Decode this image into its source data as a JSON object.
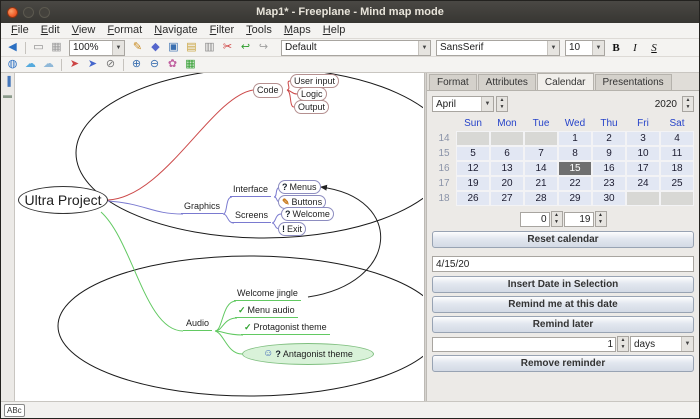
{
  "window": {
    "title": "Map1* - Freeplane - Mind map mode"
  },
  "menubar": {
    "items": [
      "File",
      "Edit",
      "View",
      "Format",
      "Navigate",
      "Filter",
      "Tools",
      "Maps",
      "Help"
    ]
  },
  "toolbar": {
    "zoom_value": "100%",
    "style_value": "Default",
    "font_value": "SansSerif",
    "size_value": "10",
    "bold_label": "B",
    "italic_label": "I",
    "strike_label": "S",
    "row1a_icons": [
      {
        "name": "speaker-icon",
        "glyph": "◀",
        "color": "#2b6fc2"
      },
      {
        "sep": true
      },
      {
        "name": "show-selection-icon",
        "glyph": "▭",
        "color": "#8a8a8a"
      },
      {
        "name": "spotlight-icon",
        "glyph": "▦",
        "color": "#9a9a9a"
      }
    ],
    "row1b_icons": [
      {
        "name": "pencil-icon",
        "glyph": "✎",
        "color": "#c8881a"
      },
      {
        "name": "style-icon",
        "glyph": "◆",
        "color": "#5566cc"
      },
      {
        "name": "save-icon",
        "glyph": "▣",
        "color": "#3a6fb0"
      },
      {
        "name": "open-folder-icon",
        "glyph": "▤",
        "color": "#c8a23a"
      },
      {
        "name": "print-icon",
        "glyph": "▥",
        "color": "#8a8a8a"
      },
      {
        "name": "cut-icon",
        "glyph": "✂",
        "color": "#cc3333"
      },
      {
        "name": "undo-icon",
        "glyph": "↩",
        "color": "#2f9e2f"
      },
      {
        "name": "redo-icon",
        "glyph": "↪",
        "color": "#9e9e9e"
      }
    ],
    "row2_icons": [
      {
        "name": "globe-icon",
        "glyph": "◍",
        "color": "#2b6fc2"
      },
      {
        "name": "cloud-icon",
        "glyph": "☁",
        "color": "#55aadd"
      },
      {
        "name": "cloud-shadow-icon",
        "glyph": "☁",
        "color": "#8fb8d8"
      },
      {
        "sep": true
      },
      {
        "name": "arrow-link-icon",
        "glyph": "➤",
        "color": "#cc4444"
      },
      {
        "name": "hyperlink-icon",
        "glyph": "➤",
        "color": "#4466cc"
      },
      {
        "name": "remove-format-icon",
        "glyph": "⊘",
        "color": "#777777"
      },
      {
        "sep": true
      },
      {
        "name": "zoom-in-icon",
        "glyph": "⊕",
        "color": "#3a6fb0"
      },
      {
        "name": "zoom-out-icon",
        "glyph": "⊖",
        "color": "#3a6fb0"
      },
      {
        "name": "icon-palette-icon",
        "glyph": "✿",
        "color": "#c060a0"
      },
      {
        "name": "grid-icon",
        "glyph": "▦",
        "color": "#2f9e2f"
      }
    ]
  },
  "sidebar": {
    "icons": [
      {
        "name": "format-panel-toggle-icon",
        "glyph": "▐",
        "color": "#4477bb"
      },
      {
        "name": "note-panel-toggle-icon",
        "glyph": "▬",
        "color": "#8a9a8a"
      }
    ]
  },
  "map": {
    "nodes": {
      "root": "Ultra Project",
      "code": "Code",
      "user_input": "User input",
      "logic": "Logic",
      "output": "Output",
      "graphics": "Graphics",
      "interface": "Interface",
      "screens": "Screens",
      "menus": "Menus",
      "buttons": "Buttons",
      "welcome": "Welcome",
      "exit": "Exit",
      "audio": "Audio",
      "welcome_jingle": "Welcome jingle",
      "menu_audio": "Menu audio",
      "protagonist": "Protagonist theme",
      "antagonist": "Antagonist theme"
    },
    "node_icons": {
      "question": "?",
      "brush": "✎",
      "exclamation": "!",
      "check": "✓",
      "smiley": "☺"
    },
    "colors": {
      "code_branch": "#cc4a4a",
      "graphics_branch": "#7a7ad0",
      "audio_branch": "#62c962",
      "cloud_outline": "#1a1a1a",
      "antagonist_fill": "#d9f2d9"
    }
  },
  "panel": {
    "tabs": [
      {
        "label": "Format"
      },
      {
        "label": "Attributes"
      },
      {
        "label": "Calendar"
      },
      {
        "label": "Presentations"
      }
    ],
    "active_tab": "Calendar",
    "calendar": {
      "month": "April",
      "year": "2020",
      "day_headers": [
        "Sun",
        "Mon",
        "Tue",
        "Wed",
        "Thu",
        "Fri",
        "Sat"
      ],
      "week_numbers": [
        "14",
        "15",
        "16",
        "17",
        "18"
      ],
      "weeks": [
        [
          "",
          "",
          "",
          "1",
          "2",
          "3",
          "4"
        ],
        [
          "5",
          "6",
          "7",
          "8",
          "9",
          "10",
          "11"
        ],
        [
          "12",
          "13",
          "14",
          "15",
          "16",
          "17",
          "18"
        ],
        [
          "19",
          "20",
          "21",
          "22",
          "23",
          "24",
          "25"
        ],
        [
          "26",
          "27",
          "28",
          "29",
          "30",
          "",
          ""
        ]
      ],
      "selected_day": "15",
      "hour_value": "0",
      "minute_value": "19"
    },
    "reset_label": "Reset calendar",
    "date_value": "4/15/20",
    "insert_label": "Insert Date in Selection",
    "remind_at_label": "Remind me at this date",
    "remind_later_label": "Remind later",
    "remind_amount": "1",
    "remind_unit": "days",
    "remove_label": "Remove reminder"
  },
  "icons": {
    "chevron_down": "▼",
    "spin_up": "▲",
    "spin_down": "▼"
  },
  "statusbar": {
    "icon_label": "ABc"
  }
}
